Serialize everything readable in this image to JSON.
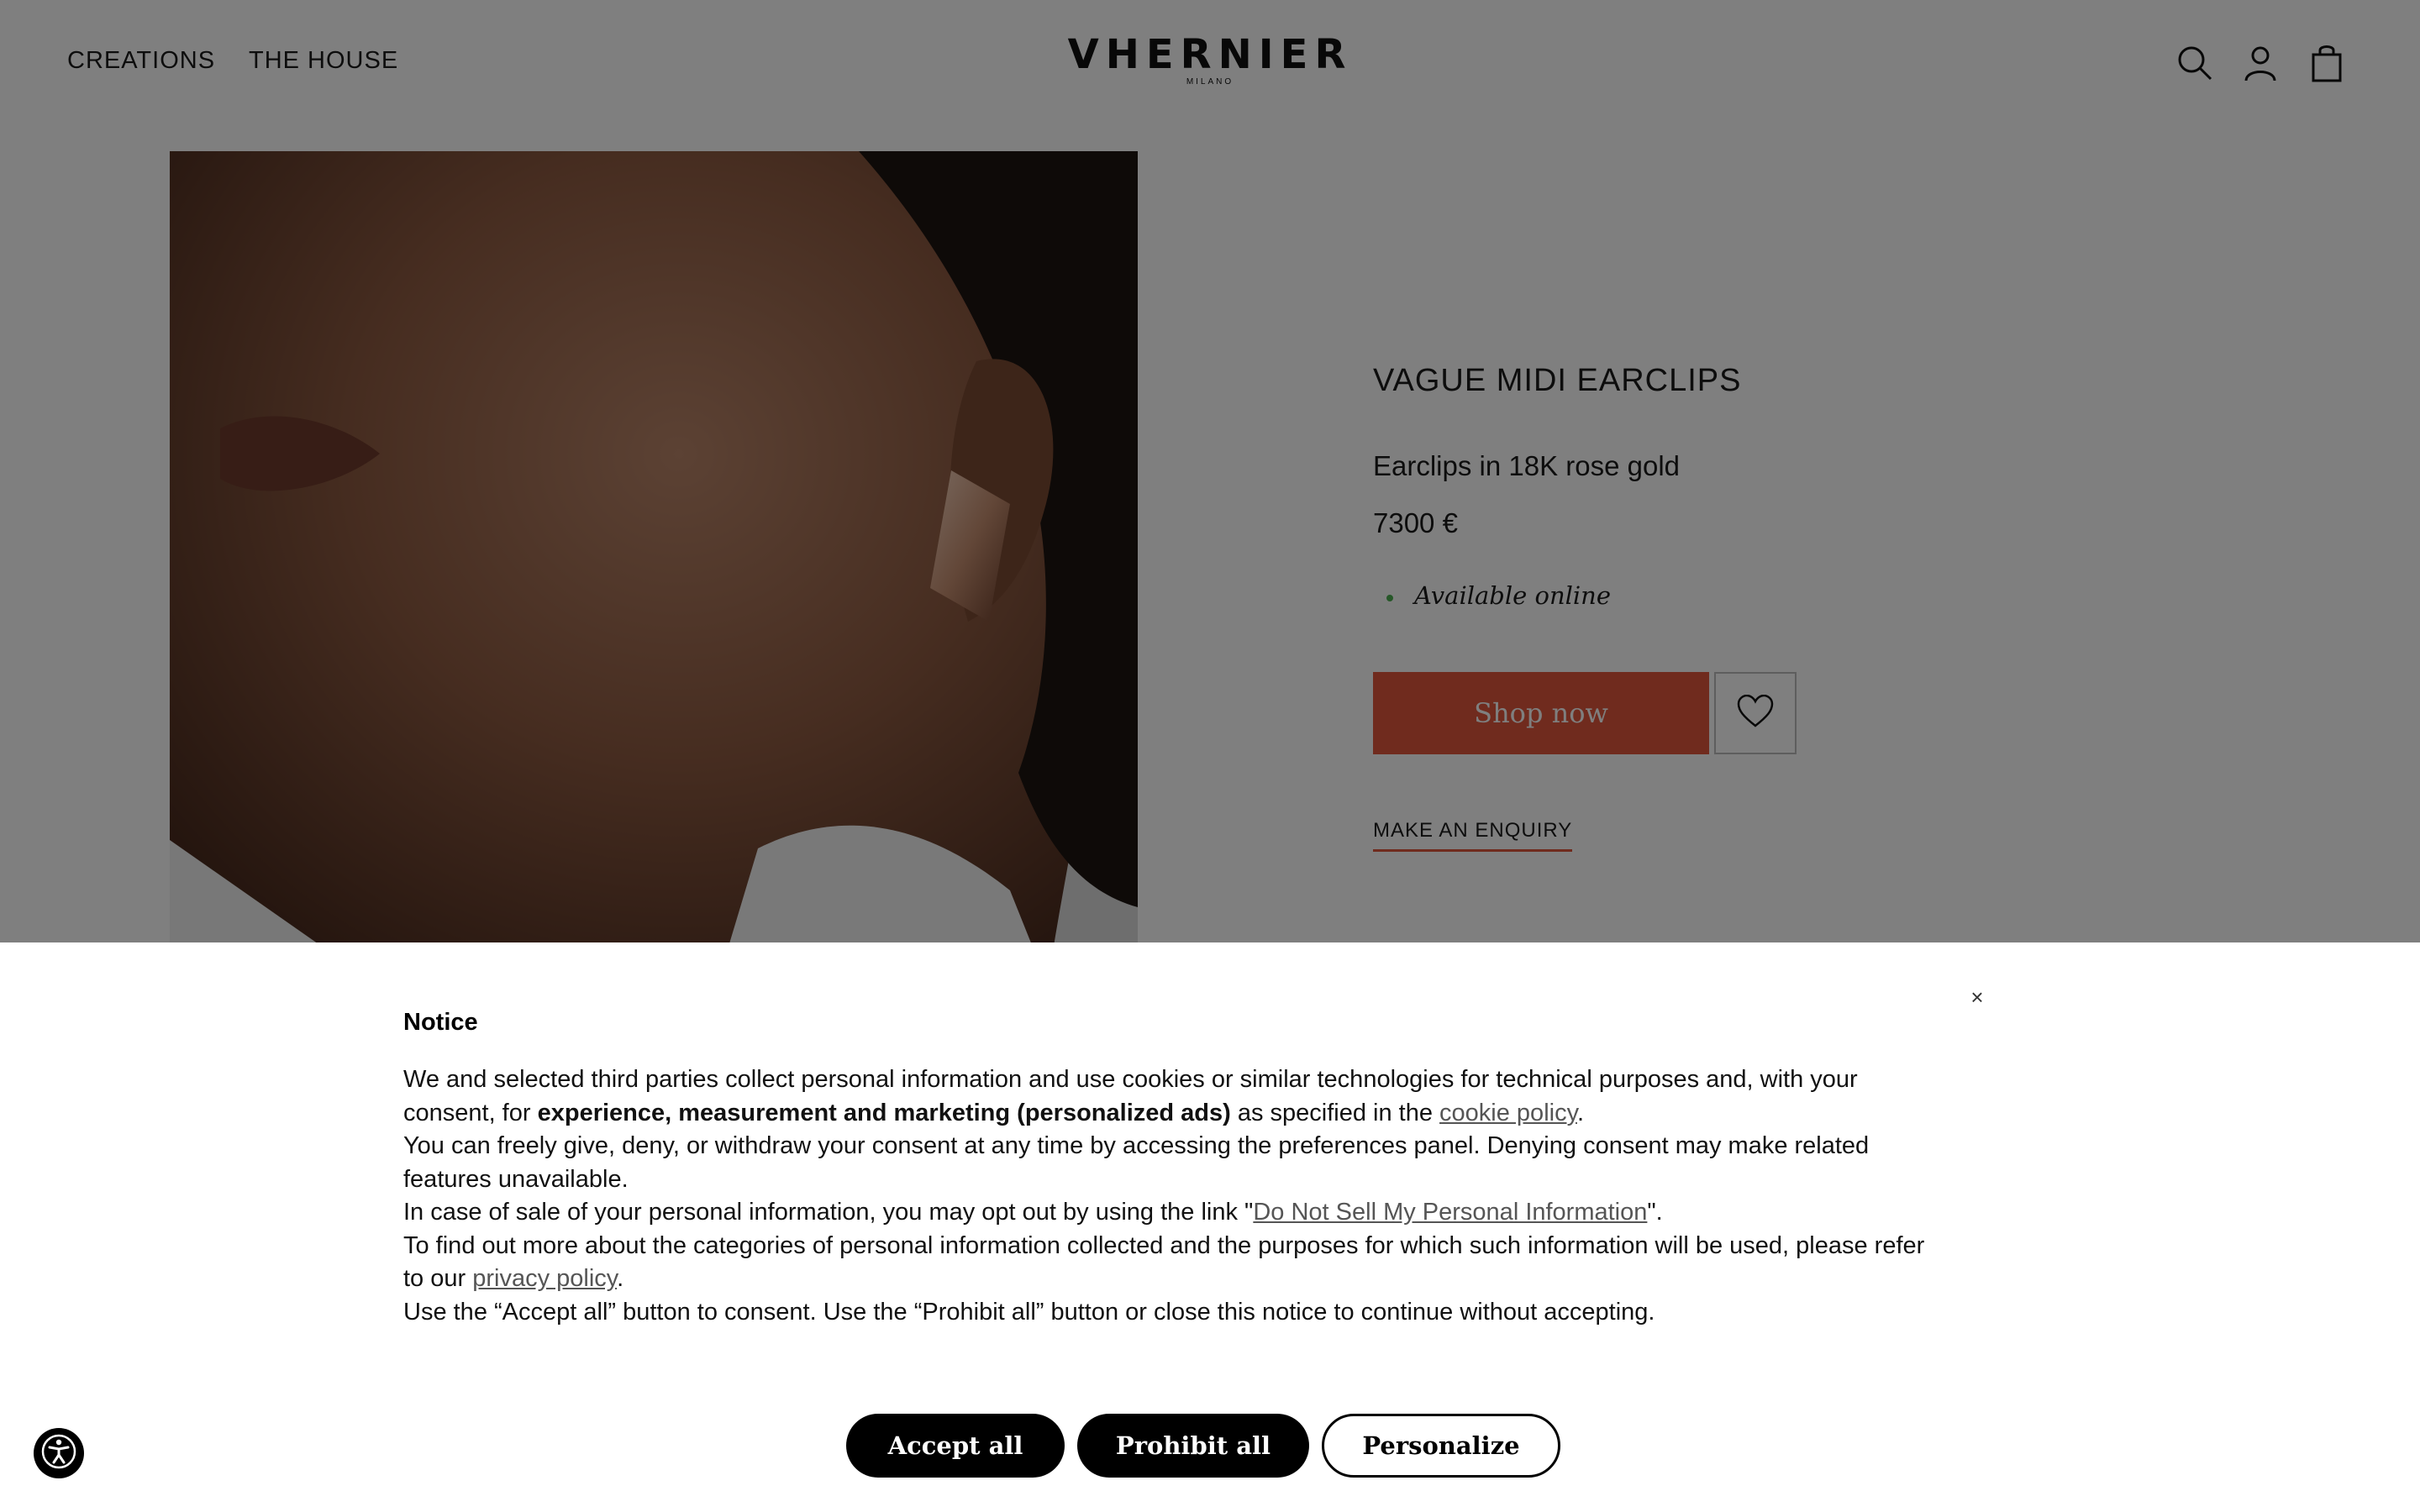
{
  "header": {
    "nav": [
      "CREATIONS",
      "THE HOUSE"
    ],
    "logo_main": "VHERNIER",
    "logo_sub": "MILANO",
    "icons": [
      "search-icon",
      "user-icon",
      "bag-icon"
    ]
  },
  "product": {
    "title": "VAGUE MIDI EARCLIPS",
    "subtitle": "Earclips in 18K rose gold",
    "price": "7300 €",
    "availability": "Available online",
    "shop_label": "Shop now",
    "enquiry_label": "MAKE AN ENQUIRY"
  },
  "consent": {
    "title": "Notice",
    "close": "×",
    "p1_a": "We and selected third parties collect personal information and use cookies or similar technologies for technical purposes and, with your consent, for ",
    "p1_bold": "experience, measurement and marketing (personalized ads)",
    "p1_b": " as specified in the ",
    "p1_link": "cookie policy",
    "p1_c": ".",
    "p2": "You can freely give, deny, or withdraw your consent at any time by accessing the preferences panel. Denying consent may make related features unavailable.",
    "p3_a": "In case of sale of your personal information, you may opt out by using the link \"",
    "p3_link": "Do Not Sell My Personal Information",
    "p3_b": "\".",
    "p4_a": "To find out more about the categories of personal information collected and the purposes for which such information will be used, please refer to our ",
    "p4_link": "privacy policy",
    "p4_b": ".",
    "p5": "Use the “Accept all” button to consent. Use the “Prohibit all” button or close this notice to continue without accepting.",
    "accept": "Accept all",
    "prohibit": "Prohibit all",
    "personalize": "Personalize"
  },
  "colors": {
    "accent": "#e0563d",
    "availability_dot": "#4caf50",
    "overlay": "rgba(0,0,0,0.5)"
  }
}
